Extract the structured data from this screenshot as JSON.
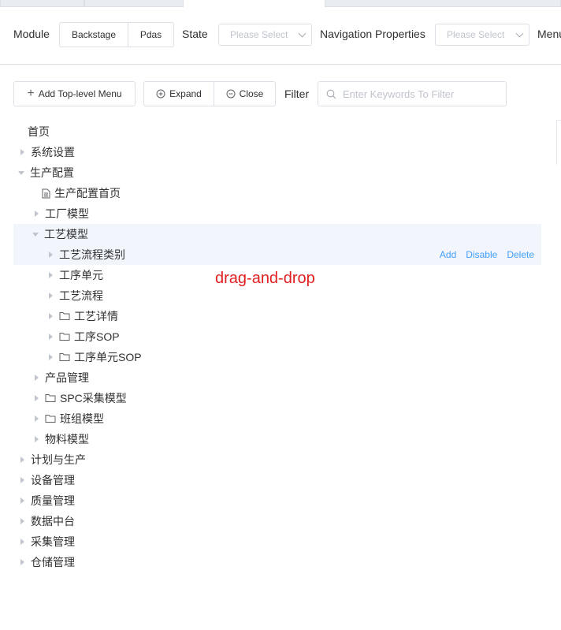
{
  "filters": {
    "module_label": "Module",
    "module_options": [
      "Backstage",
      "Pdas"
    ],
    "state_label": "State",
    "state_placeholder": "Please Select",
    "nav_label": "Navigation Properties",
    "nav_placeholder": "Please Select",
    "menu_label": "Menu"
  },
  "toolbar": {
    "add_top": "Add Top-level Menu",
    "expand": "Expand",
    "close": "Close",
    "filter_label": "Filter",
    "filter_placeholder": "Enter Keywords To Filter"
  },
  "annotation": "drag-and-drop",
  "tree": [
    {
      "label": "首页",
      "indent": 0,
      "caret": "none",
      "icon": null
    },
    {
      "label": "系统设置",
      "indent": 0,
      "caret": "right",
      "icon": null
    },
    {
      "label": "生产配置",
      "indent": 0,
      "caret": "down",
      "icon": null
    },
    {
      "label": "生产配置首页",
      "indent": 1,
      "caret": "none",
      "icon": "document-icon"
    },
    {
      "label": "工厂模型",
      "indent": 1,
      "caret": "right",
      "icon": null
    },
    {
      "label": "工艺模型",
      "indent": 1,
      "caret": "down",
      "icon": null,
      "highlight": true
    },
    {
      "label": "工艺流程类别",
      "indent": 2,
      "caret": "right",
      "icon": null,
      "highlight": true,
      "actions": [
        "Add",
        "Disable",
        "Delete"
      ]
    },
    {
      "label": "工序单元",
      "indent": 2,
      "caret": "right",
      "icon": null
    },
    {
      "label": "工艺流程",
      "indent": 2,
      "caret": "right",
      "icon": null
    },
    {
      "label": "工艺详情",
      "indent": 2,
      "caret": "right",
      "icon": "folder-icon"
    },
    {
      "label": "工序SOP",
      "indent": 2,
      "caret": "right",
      "icon": "folder-icon"
    },
    {
      "label": "工序单元SOP",
      "indent": 2,
      "caret": "right",
      "icon": "folder-icon"
    },
    {
      "label": "产品管理",
      "indent": 1,
      "caret": "right",
      "icon": null
    },
    {
      "label": "SPC采集模型",
      "indent": 1,
      "caret": "right",
      "icon": "folder-icon"
    },
    {
      "label": "班组模型",
      "indent": 1,
      "caret": "right",
      "icon": "folder-icon"
    },
    {
      "label": "物料模型",
      "indent": 1,
      "caret": "right",
      "icon": null
    },
    {
      "label": "计划与生产",
      "indent": 0,
      "caret": "right",
      "icon": null
    },
    {
      "label": "设备管理",
      "indent": 0,
      "caret": "right",
      "icon": null
    },
    {
      "label": "质量管理",
      "indent": 0,
      "caret": "right",
      "icon": null
    },
    {
      "label": "数据中台",
      "indent": 0,
      "caret": "right",
      "icon": null
    },
    {
      "label": "采集管理",
      "indent": 0,
      "caret": "right",
      "icon": null
    },
    {
      "label": "仓储管理",
      "indent": 0,
      "caret": "right",
      "icon": null
    }
  ],
  "colors": {
    "link": "#409eff",
    "highlight_row": "#f2f6fc",
    "annotation": "#e02020"
  }
}
